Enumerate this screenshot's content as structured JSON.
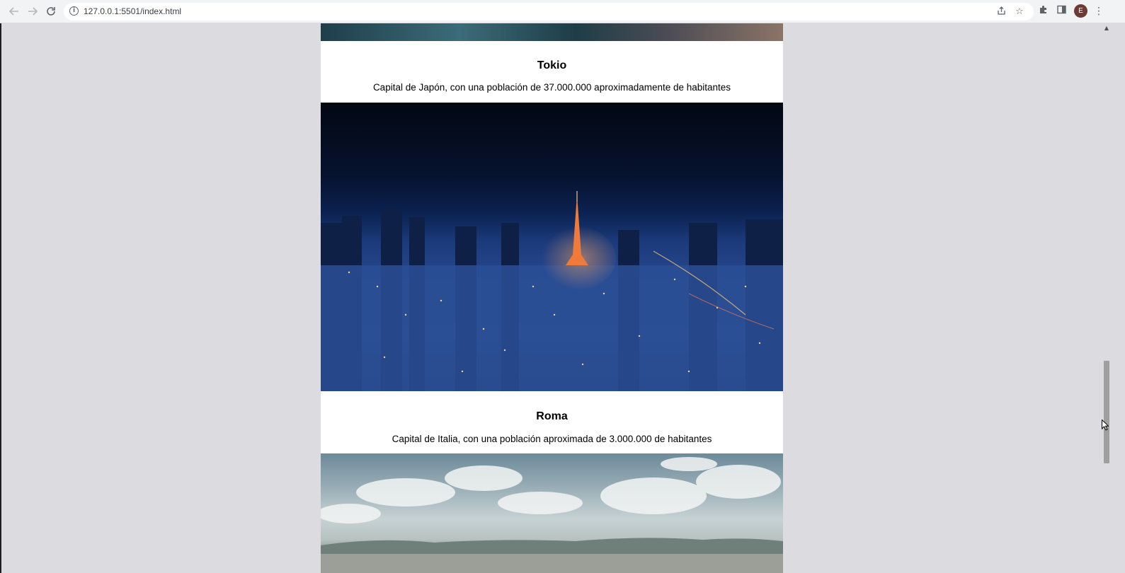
{
  "browser": {
    "url": "127.0.0.1:5501/index.html",
    "profile_initial": "E",
    "icons": {
      "back": "arrow-left-icon",
      "forward": "arrow-right-icon",
      "reload": "reload-icon",
      "site_info": "info-icon",
      "share": "share-icon",
      "bookmark": "star-icon",
      "extensions": "puzzle-icon",
      "side_panel": "side-panel-icon",
      "menu": "kebab-menu-icon"
    }
  },
  "cards": [
    {
      "title": "Tokio",
      "description": "Capital de Japón, con una población de 37.000.000 aproximadamente de habitantes"
    },
    {
      "title": "Roma",
      "description": "Capital de Italia, con una población aproximada de 3.000.000 de habitantes"
    }
  ],
  "colors": {
    "page_background": "#dcdbdf",
    "card_background": "#ffffff",
    "avatar": "#6d3b34"
  }
}
